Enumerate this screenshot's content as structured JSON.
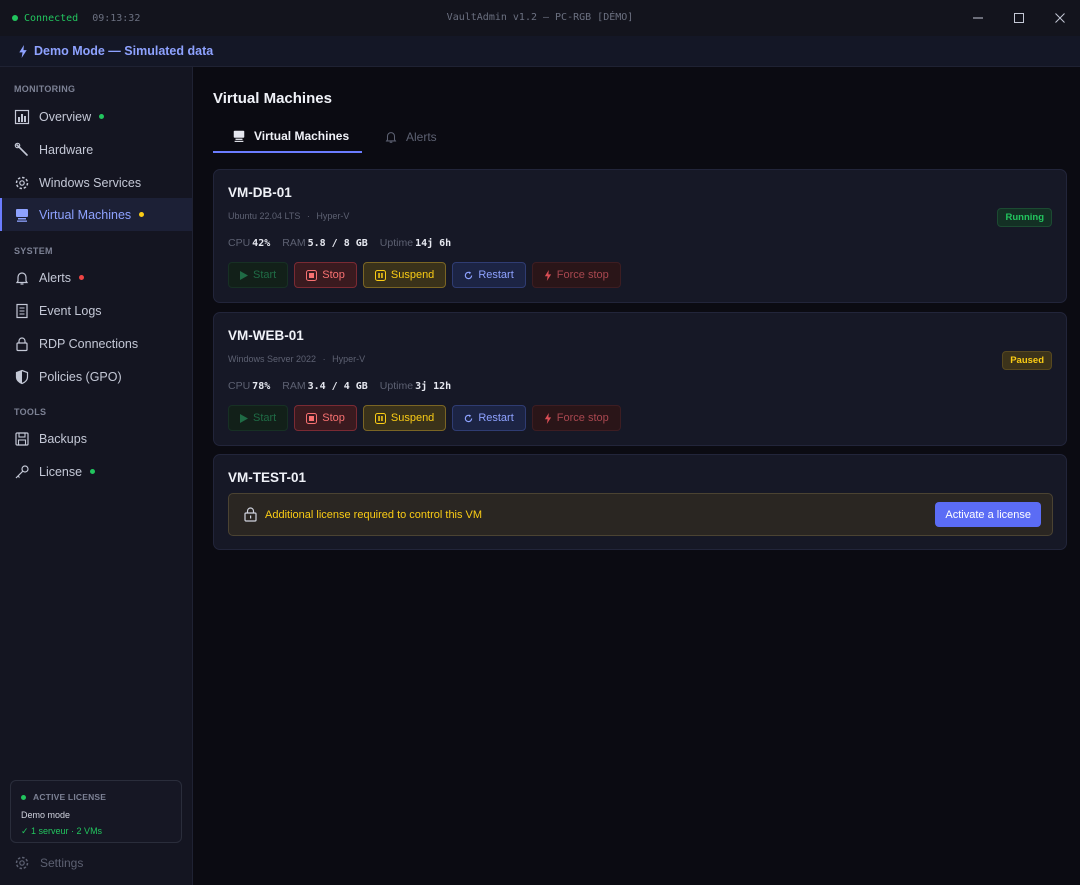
{
  "titlebar": {
    "status": "Connected",
    "time": "09:13:32",
    "title": "VaultAdmin v1.2 — PC-RGB [DÉMO]"
  },
  "demo_banner": "Demo Mode — Simulated data",
  "sidebar": {
    "sections": {
      "monitoring": "MONITORING",
      "system": "SYSTEM",
      "tools": "TOOLS"
    },
    "items": [
      {
        "label": "Overview",
        "dot": "green"
      },
      {
        "label": "Hardware"
      },
      {
        "label": "Windows Services"
      },
      {
        "label": "Virtual Machines",
        "dot": "yellow",
        "active": true
      },
      {
        "label": "Alerts",
        "dot": "red"
      },
      {
        "label": "Event Logs"
      },
      {
        "label": "RDP Connections"
      },
      {
        "label": "Policies (GPO)"
      },
      {
        "label": "Backups"
      },
      {
        "label": "License",
        "dot": "green"
      }
    ],
    "license": {
      "heading": "ACTIVE LICENSE",
      "mode": "Demo mode",
      "detail": "✓ 1 serveur · 2 VMs"
    },
    "settings": "Settings"
  },
  "main": {
    "title": "Virtual Machines",
    "tabs": [
      {
        "label": "Virtual Machines",
        "active": true
      },
      {
        "label": "Alerts"
      }
    ]
  },
  "stat_labels": {
    "cpu": "CPU",
    "ram": "RAM",
    "uptime": "Uptime"
  },
  "actions": {
    "start": "Start",
    "stop": "Stop",
    "suspend": "Suspend",
    "restart": "Restart",
    "force_stop": "Force stop"
  },
  "vms": [
    {
      "name": "VM-DB-01",
      "os": "Ubuntu 22.04 LTS",
      "hypervisor": "Hyper-V",
      "status": "Running",
      "cpu": "42%",
      "ram": "5.8 / 8 GB",
      "uptime": "14j 6h"
    },
    {
      "name": "VM-WEB-01",
      "os": "Windows Server 2022",
      "hypervisor": "Hyper-V",
      "status": "Paused",
      "cpu": "78%",
      "ram": "3.4 / 4 GB",
      "uptime": "3j 12h"
    },
    {
      "name": "VM-TEST-01",
      "locked_message": "Additional license required to control this VM",
      "activate_label": "Activate a license"
    }
  ],
  "meta_separator": "·",
  "colors": {
    "accent": "#6b7cff",
    "running": "#22c55e",
    "paused": "#facc15",
    "danger": "#f87171"
  }
}
